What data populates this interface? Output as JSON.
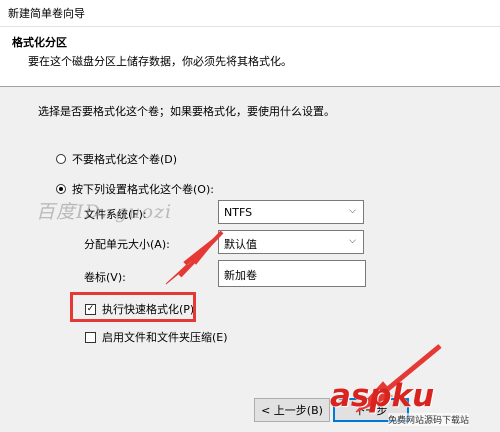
{
  "window": {
    "title": "新建简单卷向导"
  },
  "header": {
    "title": "格式化分区",
    "subtitle": "要在这个磁盘分区上储存数据，你必须先将其格式化。"
  },
  "intro": "选择是否要格式化这个卷；如果要格式化，要使用什么设置。",
  "options": {
    "no_format": "不要格式化这个卷(D)",
    "format": "按下列设置格式化这个卷(O):"
  },
  "settings": {
    "filesystem_label": "文件系统(F):",
    "filesystem_value": "NTFS",
    "alloc_label": "分配单元大小(A):",
    "alloc_value": "默认值",
    "volume_label": "卷标(V):",
    "volume_value": "新加卷"
  },
  "checkboxes": {
    "quick_format": "执行快速格式化(P)",
    "quick_format_checked": true,
    "compression": "启用文件和文件夹压缩(E)",
    "compression_checked": false
  },
  "buttons": {
    "back": "< 上一步(B)",
    "next": "下一步"
  },
  "overlays": {
    "watermark": "百度ID: guozi",
    "site_logo": "aspku",
    "site_sub": "免费网站源码下载站",
    "highlight_color": "#e53935"
  }
}
